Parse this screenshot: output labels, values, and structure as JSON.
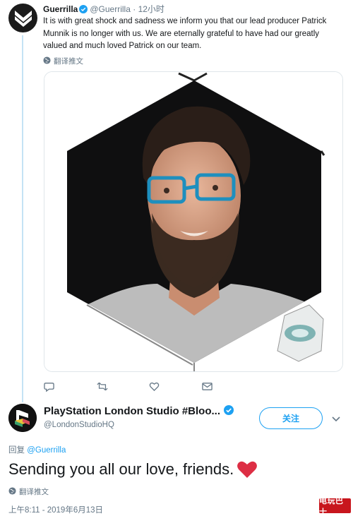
{
  "tweet1": {
    "name": "Guerrilla",
    "handle": "@Guerrilla",
    "separator": "·",
    "time": "12小时",
    "text": "It is with great shock and sadness we inform you that our lead producer Patrick Munnik is no longer with us. We are eternally grateful to have had our greatly valued and much loved Patrick on our team.",
    "translate_label": "翻译推文",
    "verified": true
  },
  "tweet2": {
    "name": "PlayStation London Studio #Bloo...",
    "handle": "@LondonStudioHQ",
    "follow_label": "关注",
    "reply_prefix": "回复",
    "reply_mention": "@Guerrilla",
    "text": "Sending you all our love, friends.",
    "translate_label": "翻译推文",
    "timestamp": "上午8:11 - 2019年6月13日",
    "verified": true
  },
  "icons": {
    "reply": "reply-icon",
    "retweet": "retweet-icon",
    "like": "heart-icon",
    "message": "envelope-icon",
    "globe": "globe-icon",
    "verified": "verified-badge-icon",
    "more": "chevron-down-icon"
  },
  "colors": {
    "accent": "#1da1f2",
    "text_primary": "#14171a",
    "text_secondary": "#657786",
    "thread_line": "#c4e3f5",
    "heart": "#e0245e",
    "watermark_bg": "#c8161d"
  },
  "watermark": {
    "text": "电玩巴士"
  }
}
